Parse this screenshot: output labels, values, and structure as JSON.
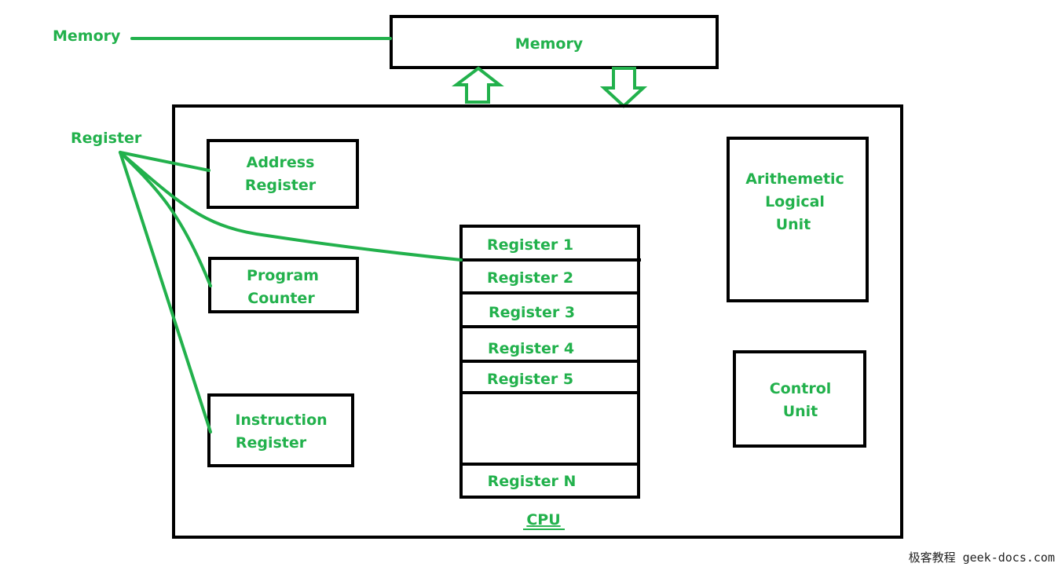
{
  "colors": {
    "accent": "#22b14c",
    "outline": "#000000"
  },
  "memory": {
    "box_label": "Memory",
    "pointer_label": "Memory"
  },
  "register_pointer_label": "Register",
  "cpu": {
    "label": "CPU"
  },
  "address_register": [
    "Address",
    "Register"
  ],
  "program_counter": [
    "Program",
    "Counter"
  ],
  "instruction_register": [
    "Instruction",
    "Register"
  ],
  "alu": [
    "Arithemetic",
    "Logical",
    "Unit"
  ],
  "control_unit": [
    "Control",
    "Unit"
  ],
  "registers": [
    "Register 1",
    "Register 2",
    "Register 3",
    "Register 4",
    "Register 5",
    "",
    "Register N"
  ],
  "watermark": "极客教程 geek-docs.com"
}
